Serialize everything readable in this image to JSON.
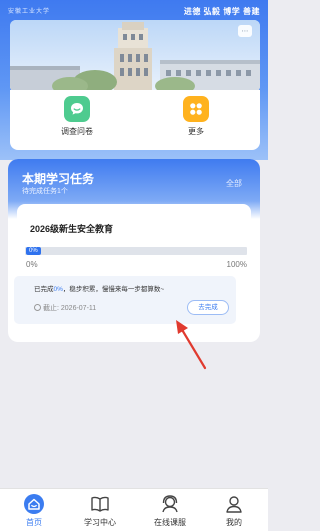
{
  "header": {
    "logo_text": "安徽工业大学",
    "slogan": "进德 弘毅 博学 善建"
  },
  "quick_menu": {
    "items": [
      {
        "label": "调查问卷",
        "icon": "survey-chat-icon",
        "color": "#4ecb8f"
      },
      {
        "label": "更多",
        "icon": "grid-more-icon",
        "color": "#ffb21e"
      }
    ]
  },
  "task_card": {
    "title": "本期学习任务",
    "subtitle": "待完成任务1个",
    "all_label": "全部",
    "course": {
      "title": "2026级新生安全教育",
      "progress": 0,
      "progress_label": "0%",
      "min_label": "0%",
      "max_label": "100%",
      "status_prefix": "已完成",
      "status_pct": "0%",
      "status_suffix": "，稳步积累，慢慢来每一步都算数~",
      "deadline_label": "截止: 2026-07-11",
      "action_label": "去完成"
    }
  },
  "bottom_nav": {
    "items": [
      {
        "label": "首页",
        "icon": "home-icon",
        "active": true
      },
      {
        "label": "学习中心",
        "icon": "book-icon",
        "active": false
      },
      {
        "label": "在线课服",
        "icon": "customer-service-icon",
        "active": false
      },
      {
        "label": "我的",
        "icon": "user-icon",
        "active": false
      }
    ]
  },
  "colors": {
    "primary": "#3b7cf0",
    "annotation_arrow": "#e03a2f"
  }
}
